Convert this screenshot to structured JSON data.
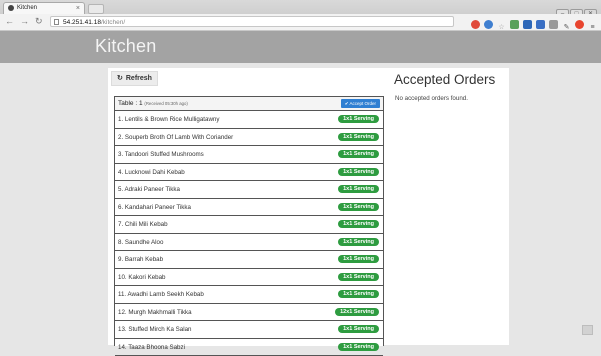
{
  "browser": {
    "tab_title": "Kitchen",
    "tab_close": "×",
    "url_host": "54.251.41.18",
    "url_path": "/kitchen/"
  },
  "app": {
    "title": "Kitchen",
    "refresh_label": "Refresh"
  },
  "order": {
    "table_label": "Table : 1",
    "received": "(Received 05:30h ago)",
    "accept_label": "✔ Accept Order",
    "items": [
      {
        "name": "1. Lentils & Brown Rice Mulligatawny",
        "qty": "1x1 Serving"
      },
      {
        "name": "2. Souperb Broth Of Lamb With Coriander",
        "qty": "1x1 Serving"
      },
      {
        "name": "3. Tandoori Stuffed Mushrooms",
        "qty": "1x1 Serving"
      },
      {
        "name": "4. Lucknowi Dahi Kebab",
        "qty": "1x1 Serving"
      },
      {
        "name": "5. Adraki Paneer Tikka",
        "qty": "1x1 Serving"
      },
      {
        "name": "6. Kandahari Paneer Tikka",
        "qty": "1x1 Serving"
      },
      {
        "name": "7. Chili Mili Kebab",
        "qty": "1x1 Serving"
      },
      {
        "name": "8. Saundhe Aloo",
        "qty": "1x1 Serving"
      },
      {
        "name": "9. Barrah Kebab",
        "qty": "1x1 Serving"
      },
      {
        "name": "10. Kakori Kebab",
        "qty": "1x1 Serving"
      },
      {
        "name": "11. Awadhi Lamb Seekh Kebab",
        "qty": "1x1 Serving"
      },
      {
        "name": "12. Murgh Makhmalli Tikka",
        "qty": "12x1 Serving"
      },
      {
        "name": "13. Stuffed Mirch Ka Salan",
        "qty": "1x1 Serving"
      },
      {
        "name": "14. Taaza Bhoona Sabzi",
        "qty": "1x1 Serving"
      }
    ]
  },
  "accepted": {
    "title": "Accepted Orders",
    "empty_message": "No accepted orders found."
  },
  "colors": {
    "header_bg": "#a3a3a3",
    "badge_green": "#2e9c40",
    "accept_blue": "#2f7fd2"
  }
}
